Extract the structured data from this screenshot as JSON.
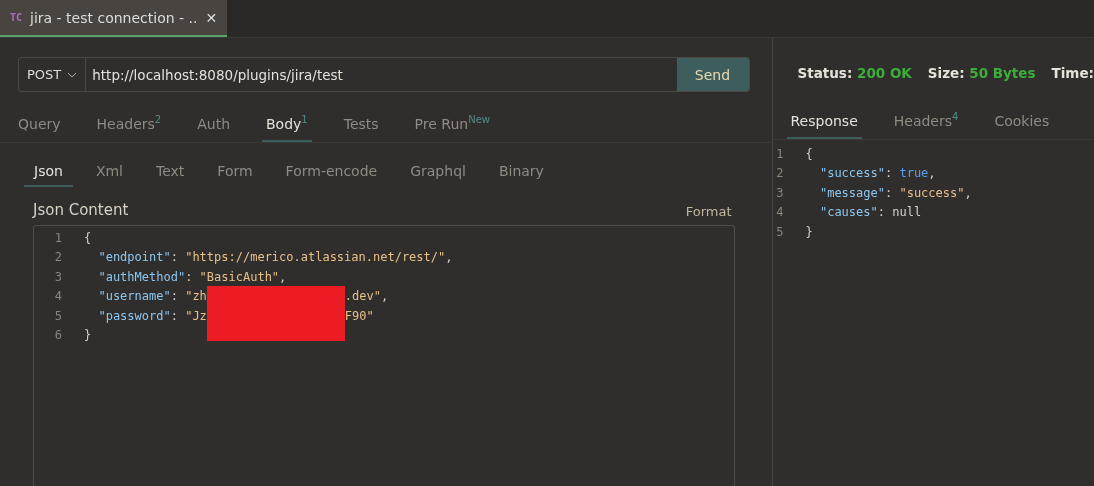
{
  "tabs": [
    {
      "badge": "TC",
      "title": "jira - test connection - ..",
      "close": "✕",
      "selected": true
    }
  ],
  "request": {
    "method": "POST",
    "url": "http://localhost:8080/plugins/jira/test",
    "send": "Send"
  },
  "request_tabs": [
    {
      "label": "Query",
      "selected": false
    },
    {
      "label": "Headers",
      "count": "2",
      "selected": false
    },
    {
      "label": "Auth",
      "selected": false
    },
    {
      "label": "Body",
      "count": "1",
      "selected": true
    },
    {
      "label": "Tests",
      "selected": false
    },
    {
      "label": "Pre Run",
      "count": "New",
      "selected": false
    }
  ],
  "body_tabs": [
    {
      "label": "Json",
      "selected": true
    },
    {
      "label": "Xml",
      "selected": false
    },
    {
      "label": "Text",
      "selected": false
    },
    {
      "label": "Form",
      "selected": false
    },
    {
      "label": "Form-encode",
      "selected": false
    },
    {
      "label": "Graphql",
      "selected": false
    },
    {
      "label": "Binary",
      "selected": false
    }
  ],
  "editor": {
    "title": "Json Content",
    "format": "Format",
    "lines": [
      {
        "number": "1",
        "tokens": [
          {
            "kind": "punct",
            "text": "{"
          }
        ]
      },
      {
        "number": "2",
        "tokens": [
          {
            "kind": "key",
            "text": "  \"endpoint\""
          },
          {
            "kind": "punct",
            "text": ": "
          },
          {
            "kind": "string",
            "text": "\"https://merico.atlassian.net/rest/\""
          },
          {
            "kind": "punct",
            "text": ","
          }
        ]
      },
      {
        "number": "3",
        "tokens": [
          {
            "kind": "key",
            "text": "  \"authMethod\""
          },
          {
            "kind": "punct",
            "text": ": "
          },
          {
            "kind": "string",
            "text": "\"BasicAuth\""
          },
          {
            "kind": "punct",
            "text": ","
          }
        ]
      },
      {
        "number": "4",
        "tokens": [
          {
            "kind": "key",
            "text": "  \"username\""
          },
          {
            "kind": "punct",
            "text": ": "
          },
          {
            "kind": "string",
            "text": "\"zh"
          },
          {
            "kind": "redaction"
          },
          {
            "kind": "string",
            "text": ".dev\""
          },
          {
            "kind": "punct",
            "text": ","
          }
        ]
      },
      {
        "number": "5",
        "tokens": [
          {
            "kind": "key",
            "text": "  \"password\""
          },
          {
            "kind": "punct",
            "text": ": "
          },
          {
            "kind": "string",
            "text": "\"Jz"
          },
          {
            "kind": "redaction"
          },
          {
            "kind": "string",
            "text": "F90\""
          }
        ]
      },
      {
        "number": "6",
        "tokens": [
          {
            "kind": "punct",
            "text": "}"
          }
        ]
      }
    ]
  },
  "response": {
    "status_label": "Status:",
    "status": "200 OK",
    "size_label": "Size:",
    "size": "50 Bytes",
    "time_label": "Time:",
    "tabs": [
      {
        "label": "Response",
        "selected": true
      },
      {
        "label": "Headers",
        "count": "4",
        "selected": false
      },
      {
        "label": "Cookies",
        "selected": false
      }
    ],
    "lines": [
      {
        "number": "1",
        "tokens": [
          {
            "kind": "punct",
            "text": "{"
          }
        ]
      },
      {
        "number": "2",
        "tokens": [
          {
            "kind": "key",
            "text": "  \"success\""
          },
          {
            "kind": "punct",
            "text": ": "
          },
          {
            "kind": "bool",
            "text": "true"
          },
          {
            "kind": "punct",
            "text": ","
          }
        ]
      },
      {
        "number": "3",
        "tokens": [
          {
            "kind": "key",
            "text": "  \"message\""
          },
          {
            "kind": "punct",
            "text": ": "
          },
          {
            "kind": "string",
            "text": "\"success\""
          },
          {
            "kind": "punct",
            "text": ","
          }
        ]
      },
      {
        "number": "4",
        "tokens": [
          {
            "kind": "key",
            "text": "  \"causes\""
          },
          {
            "kind": "punct",
            "text": ": "
          },
          {
            "kind": "null",
            "text": "null"
          }
        ]
      },
      {
        "number": "5",
        "tokens": [
          {
            "kind": "punct",
            "text": "}"
          }
        ]
      }
    ]
  }
}
